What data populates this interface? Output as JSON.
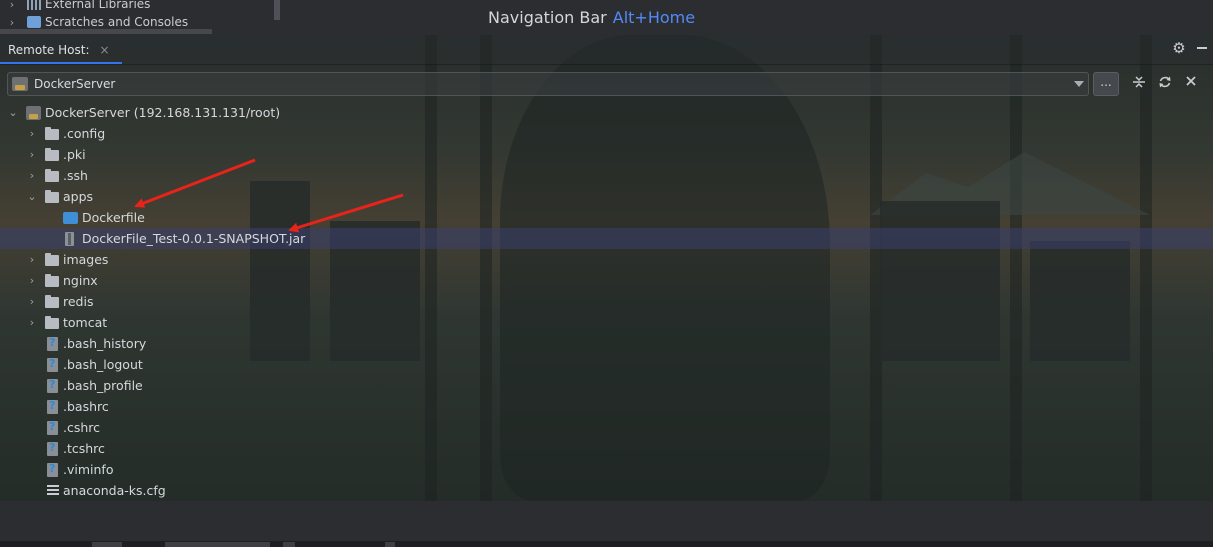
{
  "project_tree": {
    "items": [
      {
        "label": "External Libraries",
        "icon": "library-icon"
      },
      {
        "label": "Scratches and Consoles",
        "icon": "scratches-icon"
      }
    ]
  },
  "navbar_hint": {
    "label": "Navigation Bar",
    "shortcut": "Alt+Home"
  },
  "remote_host": {
    "title": "Remote Host:",
    "close_glyph": "×",
    "server": "DockerServer",
    "more_label": "..."
  },
  "tree": {
    "root": "DockerServer (192.168.131.131/root)",
    "items": [
      {
        "label": ".config",
        "type": "folder",
        "expanded": false
      },
      {
        "label": ".pki",
        "type": "folder",
        "expanded": false
      },
      {
        "label": ".ssh",
        "type": "folder",
        "expanded": false
      },
      {
        "label": "apps",
        "type": "folder",
        "expanded": true
      },
      {
        "label": "Dockerfile",
        "type": "dockerfile"
      },
      {
        "label": "DockerFile_Test-0.0.1-SNAPSHOT.jar",
        "type": "jar",
        "selected": true
      },
      {
        "label": "images",
        "type": "folder",
        "expanded": false
      },
      {
        "label": "nginx",
        "type": "folder",
        "expanded": false
      },
      {
        "label": "redis",
        "type": "folder",
        "expanded": false
      },
      {
        "label": "tomcat",
        "type": "folder",
        "expanded": false
      },
      {
        "label": ".bash_history",
        "type": "unknown"
      },
      {
        "label": ".bash_logout",
        "type": "unknown"
      },
      {
        "label": ".bash_profile",
        "type": "unknown"
      },
      {
        "label": ".bashrc",
        "type": "unknown"
      },
      {
        "label": ".cshrc",
        "type": "unknown"
      },
      {
        "label": ".tcshrc",
        "type": "unknown"
      },
      {
        "label": ".viminfo",
        "type": "unknown"
      },
      {
        "label": "anaconda-ks.cfg",
        "type": "text"
      }
    ]
  },
  "colors": {
    "accent": "#548af7",
    "annotation_arrow": "#e8231a",
    "selection": "#3a406e"
  }
}
